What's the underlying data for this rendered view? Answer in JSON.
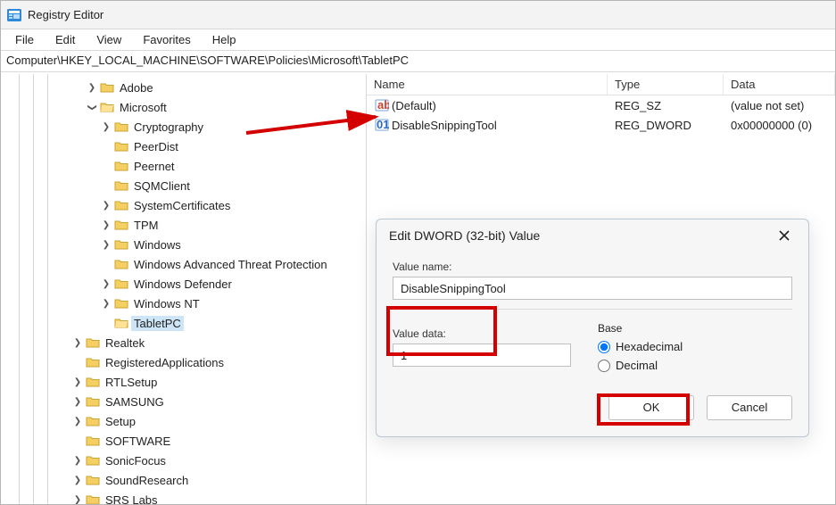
{
  "window": {
    "title": "Registry Editor"
  },
  "menubar": {
    "file": "File",
    "edit": "Edit",
    "view": "View",
    "favorites": "Favorites",
    "help": "Help"
  },
  "address": "Computer\\HKEY_LOCAL_MACHINE\\SOFTWARE\\Policies\\Microsoft\\TabletPC",
  "tree": {
    "adobe": "Adobe",
    "microsoft": "Microsoft",
    "cryptography": "Cryptography",
    "peerdist": "PeerDist",
    "peernet": "Peernet",
    "sqmclient": "SQMClient",
    "systemcertificates": "SystemCertificates",
    "tpm": "TPM",
    "windows": "Windows",
    "watp": "Windows Advanced Threat Protection",
    "defender": "Windows Defender",
    "winnt": "Windows NT",
    "tabletpc": "TabletPC",
    "realtek": "Realtek",
    "regapps": "RegisteredApplications",
    "rtlsetup": "RTLSetup",
    "samsung": "SAMSUNG",
    "setup": "Setup",
    "software": "SOFTWARE",
    "sonicfocus": "SonicFocus",
    "soundresearch": "SoundResearch",
    "srslabs": "SRS Labs"
  },
  "list": {
    "headers": {
      "name": "Name",
      "type": "Type",
      "data": "Data"
    },
    "rows": [
      {
        "name": "(Default)",
        "type": "REG_SZ",
        "data": "(value not set)"
      },
      {
        "name": "DisableSnippingTool",
        "type": "REG_DWORD",
        "data": "0x00000000 (0)"
      }
    ]
  },
  "dialog": {
    "title": "Edit DWORD (32-bit) Value",
    "value_name_label": "Value name:",
    "value_name": "DisableSnippingTool",
    "value_data_label": "Value data:",
    "value_data": "1",
    "base_label": "Base",
    "hex": "Hexadecimal",
    "dec": "Decimal",
    "ok": "OK",
    "cancel": "Cancel"
  }
}
